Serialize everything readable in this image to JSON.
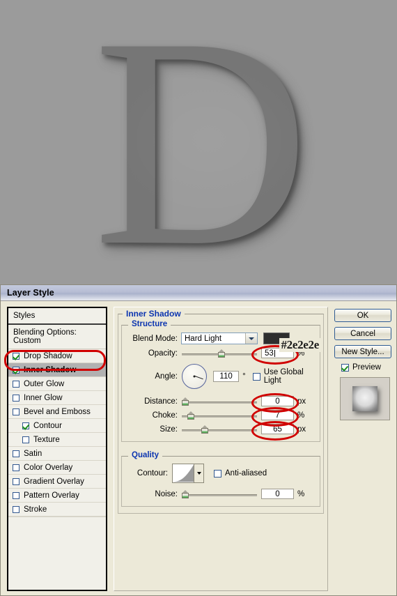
{
  "artwork": {
    "letter": "D",
    "background_color": "#9b9b9b",
    "letter_color": "#767676"
  },
  "dialog": {
    "title": "Layer Style"
  },
  "styles_panel": {
    "header": "Styles",
    "blending_options": "Blending Options: Custom",
    "items": [
      {
        "label": "Drop Shadow",
        "checked": true,
        "indent": false,
        "selected": false
      },
      {
        "label": "Inner Shadow",
        "checked": true,
        "indent": false,
        "selected": true
      },
      {
        "label": "Outer Glow",
        "checked": false,
        "indent": false,
        "selected": false
      },
      {
        "label": "Inner Glow",
        "checked": false,
        "indent": false,
        "selected": false
      },
      {
        "label": "Bevel and Emboss",
        "checked": false,
        "indent": false,
        "selected": false
      },
      {
        "label": "Contour",
        "checked": true,
        "indent": true,
        "selected": false
      },
      {
        "label": "Texture",
        "checked": false,
        "indent": true,
        "selected": false
      },
      {
        "label": "Satin",
        "checked": false,
        "indent": false,
        "selected": false
      },
      {
        "label": "Color Overlay",
        "checked": false,
        "indent": false,
        "selected": false
      },
      {
        "label": "Gradient Overlay",
        "checked": false,
        "indent": false,
        "selected": false
      },
      {
        "label": "Pattern Overlay",
        "checked": false,
        "indent": false,
        "selected": false
      },
      {
        "label": "Stroke",
        "checked": false,
        "indent": false,
        "selected": false
      }
    ]
  },
  "settings": {
    "section_title": "Inner Shadow",
    "structure": {
      "legend": "Structure",
      "blend_mode_label": "Blend Mode:",
      "blend_mode_value": "Hard Light",
      "shadow_color": "#2e2e2e",
      "hex_annotation": "#2e2e2e",
      "opacity_label": "Opacity:",
      "opacity_value": "53",
      "opacity_unit": "%",
      "opacity_pct": 53,
      "angle_label": "Angle:",
      "angle_value": "110",
      "angle_unit": "°",
      "use_global_light_label": "Use Global Light",
      "use_global_light_checked": false,
      "distance_label": "Distance:",
      "distance_value": "0",
      "distance_unit": "px",
      "distance_pct": 0,
      "choke_label": "Choke:",
      "choke_value": "7",
      "choke_unit": "%",
      "choke_pct": 7,
      "size_label": "Size:",
      "size_value": "65",
      "size_unit": "px",
      "size_pct": 26
    },
    "quality": {
      "legend": "Quality",
      "contour_label": "Contour:",
      "anti_aliased_label": "Anti-aliased",
      "anti_aliased_checked": false,
      "noise_label": "Noise:",
      "noise_value": "0",
      "noise_unit": "%",
      "noise_pct": 0
    }
  },
  "buttons": {
    "ok": "OK",
    "cancel": "Cancel",
    "new_style": "New Style...",
    "preview_label": "Preview",
    "preview_checked": true
  },
  "annotation": {
    "highlight_color": "#d00000"
  }
}
